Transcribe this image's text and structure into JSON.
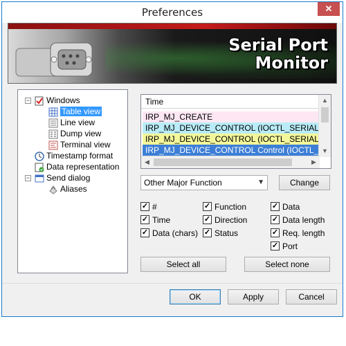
{
  "window": {
    "title": "Preferences",
    "close_glyph": "✕"
  },
  "banner": {
    "line1": "Serial Port",
    "line2": "Monitor"
  },
  "tree": {
    "windows": "Windows",
    "table_view": "Table view",
    "line_view": "Line view",
    "dump_view": "Dump view",
    "terminal_view": "Terminal view",
    "timestamp_format": "Timestamp format",
    "data_representation": "Data representation",
    "send_dialog": "Send dialog",
    "aliases": "Aliases"
  },
  "list": {
    "header": "Time",
    "rows": [
      "IRP_MJ_CREATE",
      "IRP_MJ_DEVICE_CONTROL (IOCTL_SERIAL_GET_...",
      "IRP_MJ_DEVICE_CONTROL (IOCTL_SERIAL_SET_...",
      "IRP_MJ_DEVICE_CONTROL Control (IOCTL_SERIA..."
    ],
    "row_colors": [
      "#fde7f3",
      "#b9ecf7",
      "#f3f79a",
      "#3d7fd6"
    ]
  },
  "controls": {
    "major_function": "Other Major Function",
    "change": "Change",
    "select_all": "Select all",
    "select_none": "Select none"
  },
  "checks": {
    "hash": "#",
    "time": "Time",
    "data_chars": "Data (chars)",
    "function": "Function",
    "direction": "Direction",
    "status": "Status",
    "data": "Data",
    "data_length": "Data length",
    "req_length": "Req. length",
    "port": "Port"
  },
  "buttons": {
    "ok": "OK",
    "apply": "Apply",
    "cancel": "Cancel"
  }
}
